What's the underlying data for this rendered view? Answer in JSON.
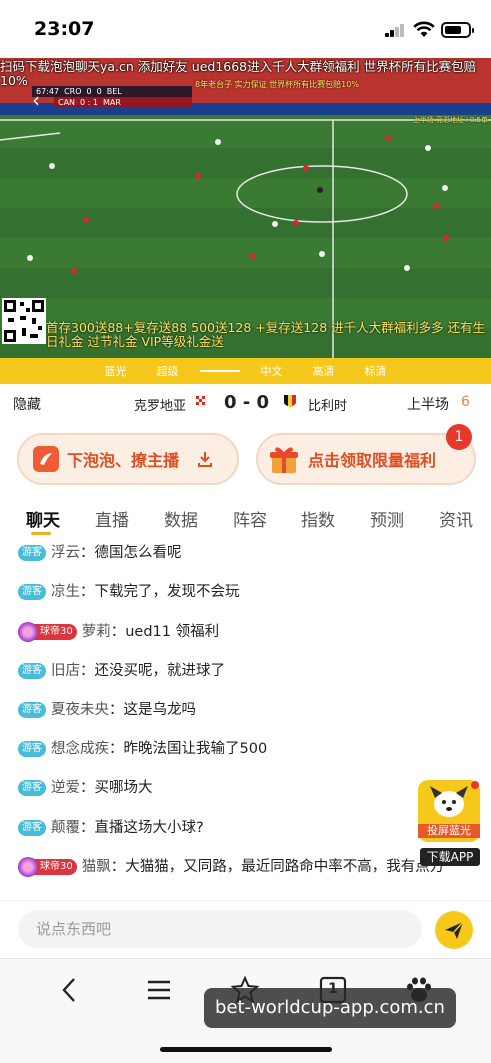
{
  "status": {
    "time": "23:07"
  },
  "video": {
    "marquee": "扫码下载泡泡聊天ya.cn 添加好友 ued1668进入千人大群领福利 世界杯所有比赛包赔10%",
    "scorebug": {
      "time": "67:47",
      "home_code": "CRO",
      "home_score": "0",
      "away_score": "0",
      "away_code": "BEL",
      "sub_left": "CAN",
      "sub_mid": "0 : 1",
      "sub_right": "MAR"
    },
    "ad_top": "8年老台子 实力保证 世界杯所有比赛包赔10%",
    "ad_right": "上半场 竞彩地址+0.5单",
    "promo": "首存300送88+复存送88 500送128 +复存送128 进千人大群福利多多 还有生日礼金 过节礼金 VIP等级礼金送"
  },
  "quality": {
    "tabs": [
      "蓝光",
      "超级",
      "",
      "中文",
      "高清",
      "标清"
    ]
  },
  "match": {
    "hide": "隐藏",
    "home": "克罗地亚",
    "score": "0 - 0",
    "away": "比利时",
    "period": "上半场",
    "period_num": "6"
  },
  "buttons": {
    "left": "下泡泡、撩主播",
    "right": "点击领取限量福利",
    "badge": "1"
  },
  "tabs": [
    "聊天",
    "直播",
    "数据",
    "阵容",
    "指数",
    "预测",
    "资讯"
  ],
  "chat": [
    {
      "tag": "游客",
      "vip": false,
      "nick": "浮云",
      "text": "德国怎么看呢"
    },
    {
      "tag": "游客",
      "vip": false,
      "nick": "凉生",
      "text": "下载完了，发现不会玩"
    },
    {
      "tag": "球帝30",
      "vip": true,
      "nick": "萝莉",
      "text": "ued11 领福利"
    },
    {
      "tag": "游客",
      "vip": false,
      "nick": "旧店",
      "text": "还没买呢，就进球了"
    },
    {
      "tag": "游客",
      "vip": false,
      "nick": "夏夜未央",
      "text": "这是乌龙吗"
    },
    {
      "tag": "游客",
      "vip": false,
      "nick": "想念成疾",
      "text": "昨晚法国让我输了500"
    },
    {
      "tag": "游客",
      "vip": false,
      "nick": "逆爱",
      "text": "买哪场大"
    },
    {
      "tag": "游客",
      "vip": false,
      "nick": "颠覆",
      "text": "直播这场大小球?"
    },
    {
      "tag": "球帝30",
      "vip": true,
      "nick": "猫飘",
      "text": "大猫猫，又同路，最近同路命中率不高，我有点方"
    }
  ],
  "float_app": {
    "label": "投屏蓝光",
    "download": "下载APP"
  },
  "input": {
    "placeholder": "说点东西吧"
  },
  "browser": {
    "tab_count": "1",
    "watermark": "bet-worldcup-app.com.cn"
  }
}
